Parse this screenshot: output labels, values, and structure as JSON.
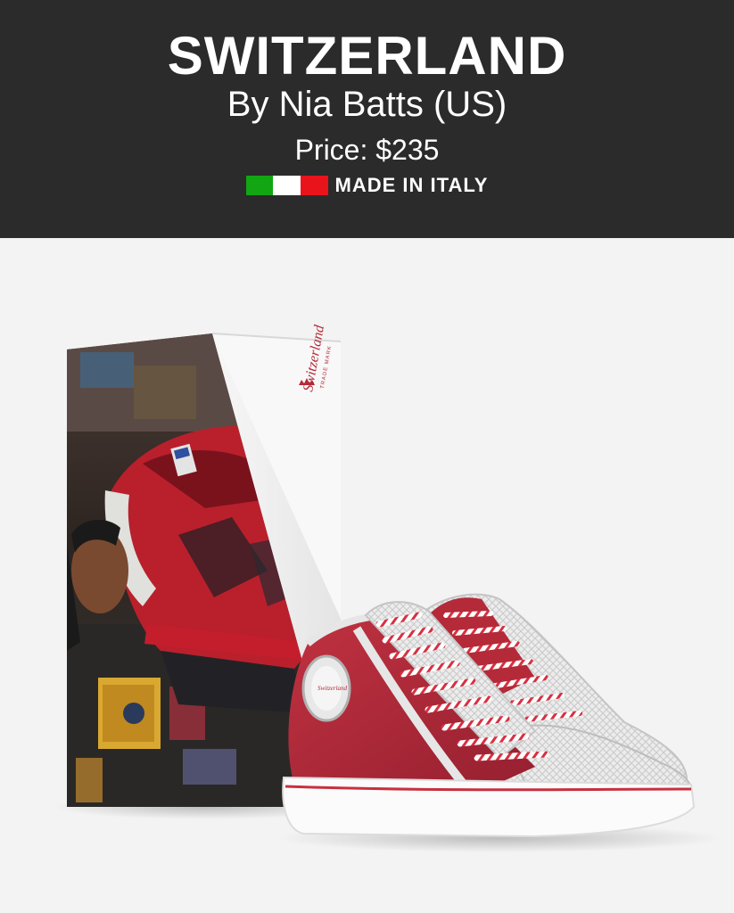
{
  "product": {
    "name": "SWITZERLAND",
    "designer": "By Nia Batts (US)",
    "price": "Price: $235",
    "origin": "MADE IN ITALY"
  },
  "flag": {
    "colors": [
      "#11a612",
      "#ffffff",
      "#e9131c"
    ]
  },
  "image": {
    "box_brand": "Switzerland",
    "box_tagline": "TRADE MARK",
    "colors": {
      "shoe_body": "#b42a38",
      "shoe_trim": "#e9e9e9",
      "sole_stripe": "#c8303f",
      "jacket": "#b9202c",
      "background": "#f3f3f3"
    }
  }
}
